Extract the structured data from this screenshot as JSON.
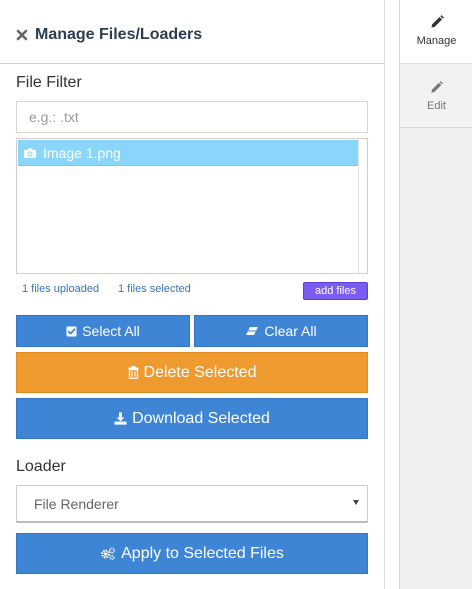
{
  "header": {
    "title": "Manage Files/Loaders",
    "close_icon": "close-icon"
  },
  "file_filter": {
    "label": "File Filter",
    "placeholder": "e.g.: .txt",
    "value": ""
  },
  "file_list": {
    "items": [
      {
        "name": "Image 1.png",
        "icon": "camera-icon",
        "selected": true
      }
    ]
  },
  "status": {
    "uploaded": "1 files uploaded",
    "selected": "1 files selected",
    "add_files_label": "add files"
  },
  "buttons": {
    "select_all": "Select All",
    "clear_all": "Clear All",
    "delete_selected": "Delete Selected",
    "download_selected": "Download Selected",
    "apply": "Apply to Selected Files"
  },
  "loader": {
    "label": "Loader",
    "selected": "File Renderer"
  },
  "tabs": [
    {
      "label": "Manage",
      "icon": "pencil-icon",
      "active": true
    },
    {
      "label": "Edit",
      "icon": "pencil-icon",
      "active": false
    }
  ],
  "colors": {
    "primary_blue": "#3f85d6",
    "danger_orange": "#ee9a2f",
    "selection_blue": "#8ad6fb",
    "add_files_purple": "#7b5cf0",
    "title_navy": "#2c3e50"
  }
}
